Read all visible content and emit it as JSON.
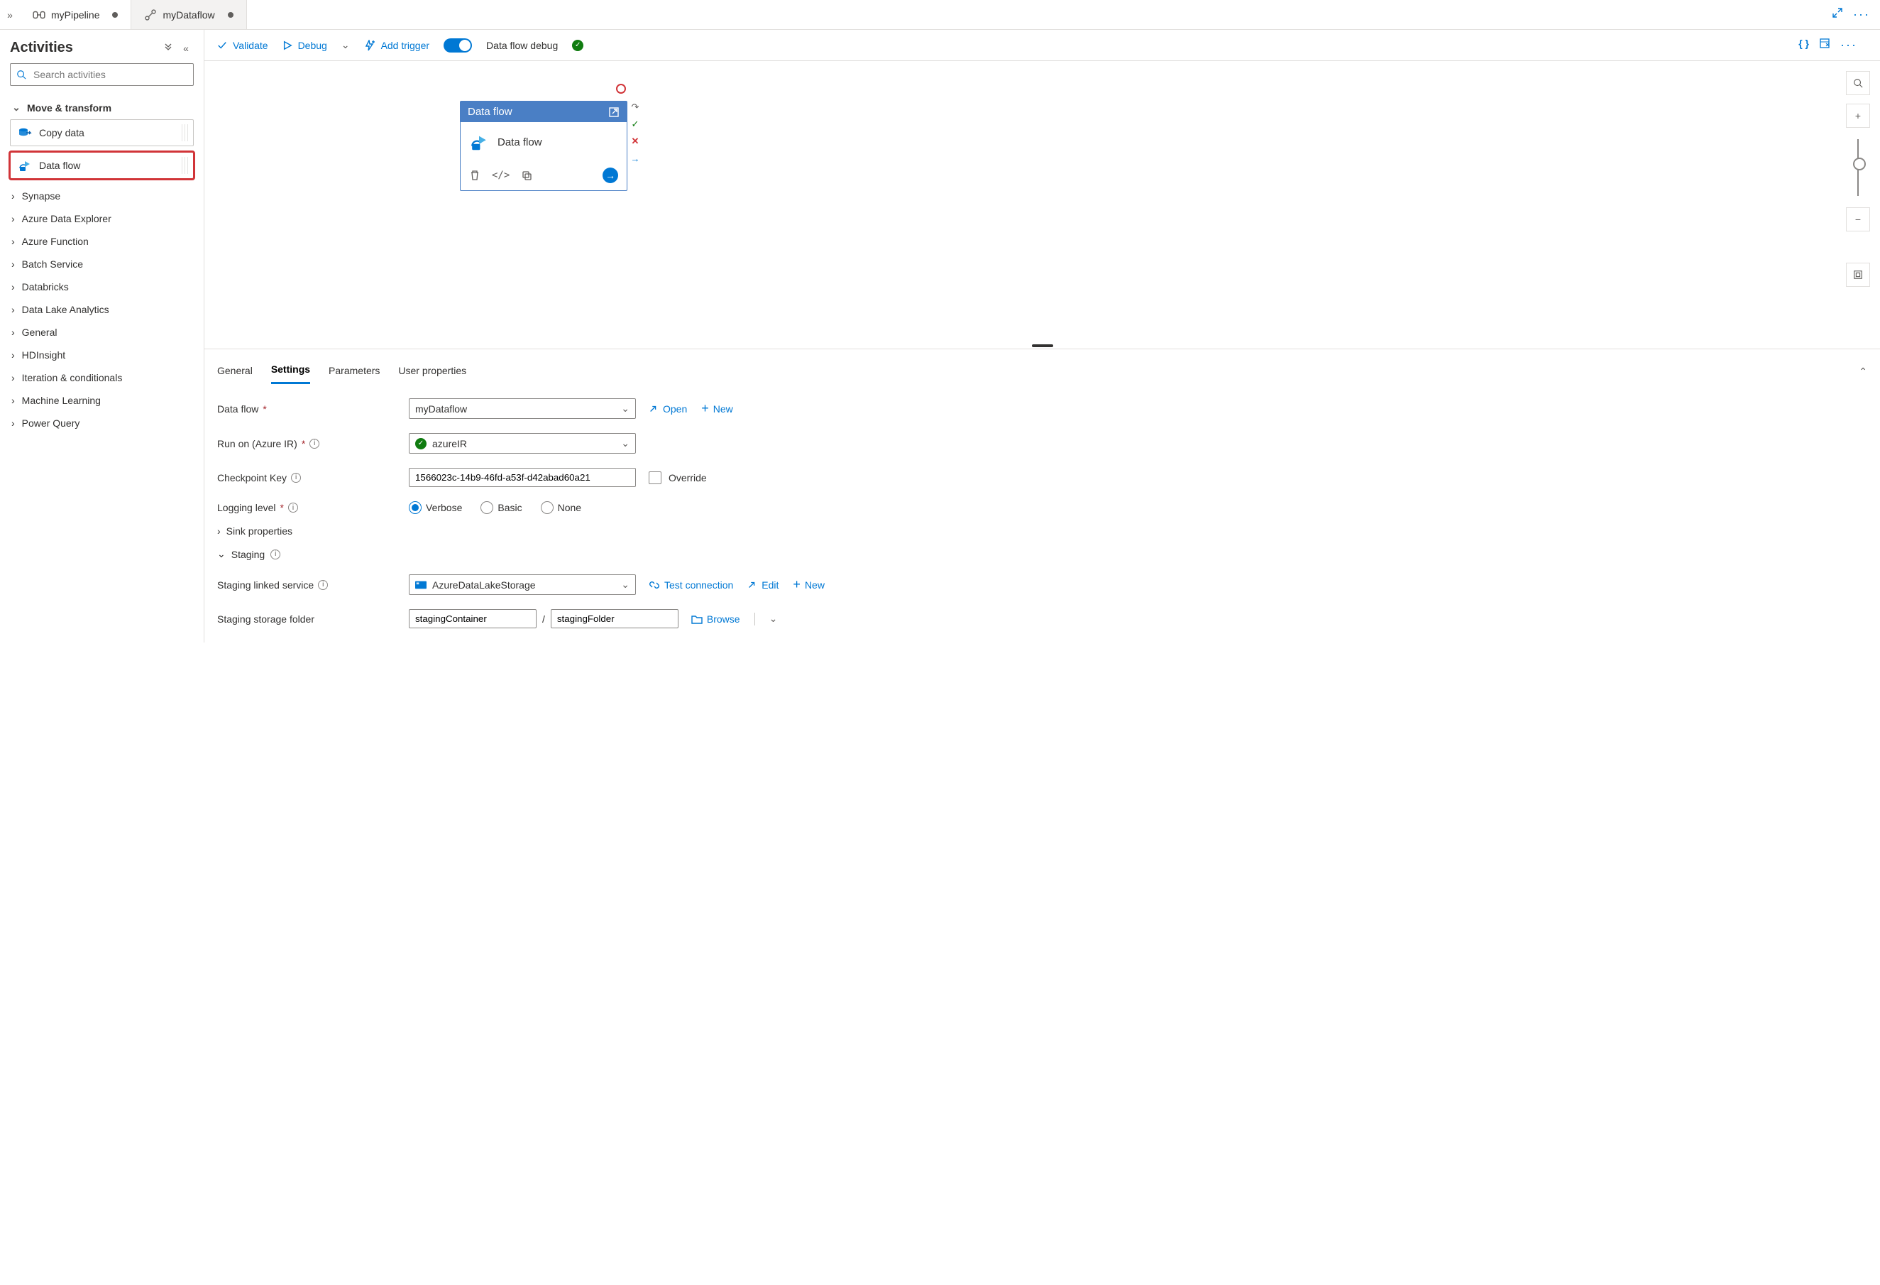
{
  "tabs": {
    "pipeline": "myPipeline",
    "dataflow": "myDataflow"
  },
  "sidebar": {
    "title": "Activities",
    "searchPlaceholder": "Search activities",
    "moveTransform": {
      "label": "Move & transform",
      "copyData": "Copy data",
      "dataFlow": "Data flow"
    },
    "categories": [
      "Synapse",
      "Azure Data Explorer",
      "Azure Function",
      "Batch Service",
      "Databricks",
      "Data Lake Analytics",
      "General",
      "HDInsight",
      "Iteration & conditionals",
      "Machine Learning",
      "Power Query"
    ]
  },
  "toolbar": {
    "validate": "Validate",
    "debug": "Debug",
    "addTrigger": "Add trigger",
    "dataFlowDebug": "Data flow debug"
  },
  "canvas": {
    "nodeTitle": "Data flow",
    "nodeBody": "Data flow"
  },
  "propsTabs": {
    "general": "General",
    "settings": "Settings",
    "parameters": "Parameters",
    "userProperties": "User properties"
  },
  "settings": {
    "dataFlowLabel": "Data flow",
    "dataFlowValue": "myDataflow",
    "open": "Open",
    "new": "New",
    "runOnLabel": "Run on (Azure IR)",
    "runOnValue": "azureIR",
    "checkpointLabel": "Checkpoint Key",
    "checkpointValue": "1566023c-14b9-46fd-a53f-d42abad60a21",
    "overrideLabel": "Override",
    "loggingLabel": "Logging level",
    "loggingOptions": {
      "verbose": "Verbose",
      "basic": "Basic",
      "none": "None"
    },
    "sinkProps": "Sink properties",
    "staging": "Staging",
    "stagingLinkedLabel": "Staging linked service",
    "stagingLinkedValue": "AzureDataLakeStorage",
    "testConnection": "Test connection",
    "edit": "Edit",
    "stagingFolderLabel": "Staging storage folder",
    "stagingContainer": "stagingContainer",
    "stagingFolder": "stagingFolder",
    "browse": "Browse"
  }
}
